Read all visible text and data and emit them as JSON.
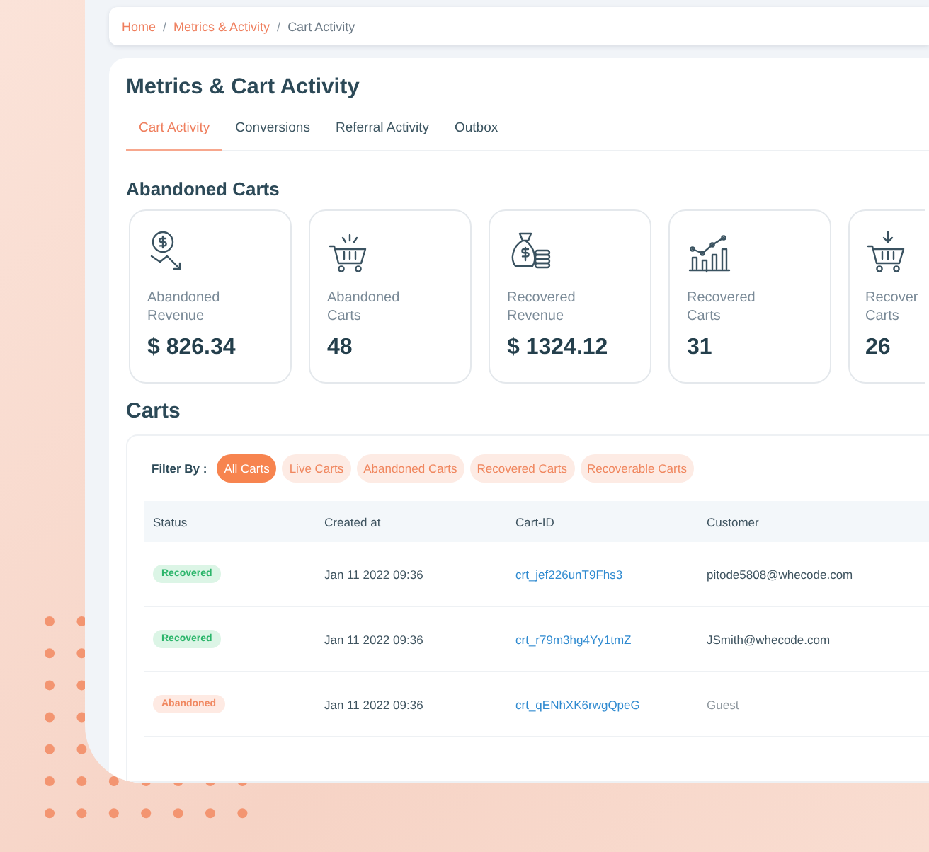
{
  "breadcrumb": [
    {
      "label": "Home",
      "link": true
    },
    {
      "label": "Metrics & Activity",
      "link": true
    },
    {
      "label": "Cart Activity",
      "link": false
    }
  ],
  "breadcrumb_separator": "/",
  "title": "Metrics & Cart Activity",
  "tabs": [
    {
      "label": "Cart Activity",
      "selected": true
    },
    {
      "label": "Conversions",
      "selected": false
    },
    {
      "label": "Referral Activity",
      "selected": false
    },
    {
      "label": "Outbox",
      "selected": false
    }
  ],
  "metrics_heading": "Abandoned Carts",
  "metrics": [
    {
      "label": "Abandoned Revenue",
      "value": "$ 826.34"
    },
    {
      "label": "Abandoned Carts",
      "value": "48"
    },
    {
      "label": "Recovered Revenue",
      "value": "$ 1324.12"
    },
    {
      "label": "Recovered Carts",
      "value": "31"
    },
    {
      "label": "Recover Carts",
      "value": "26"
    }
  ],
  "carts_heading": "Carts",
  "filter_label": "Filter By :",
  "filters": [
    {
      "label": "All Carts",
      "selected": true
    },
    {
      "label": "Live Carts",
      "selected": false
    },
    {
      "label": "Abandoned Carts",
      "selected": false
    },
    {
      "label": "Recovered Carts",
      "selected": false
    },
    {
      "label": "Recoverable Carts",
      "selected": false
    }
  ],
  "table": {
    "columns": [
      "Status",
      "Created at",
      "Cart-ID",
      "Customer"
    ],
    "rows": [
      {
        "status": "Recovered",
        "kind": "recovered",
        "created": "Jan 11 2022 09:36",
        "cart_id": "crt_jef226unT9Fhs3",
        "customer": "pitode5808@whecode.com",
        "guest": false
      },
      {
        "status": "Recovered",
        "kind": "recovered",
        "created": "Jan 11 2022 09:36",
        "cart_id": "crt_r79m3hg4Yy1tmZ",
        "customer": "JSmith@whecode.com",
        "guest": false
      },
      {
        "status": "Abandoned",
        "kind": "abandoned",
        "created": "Jan 11 2022 09:36",
        "cart_id": "crt_qENhXK6rwgQpeG",
        "customer": "Guest",
        "guest": true
      }
    ]
  }
}
